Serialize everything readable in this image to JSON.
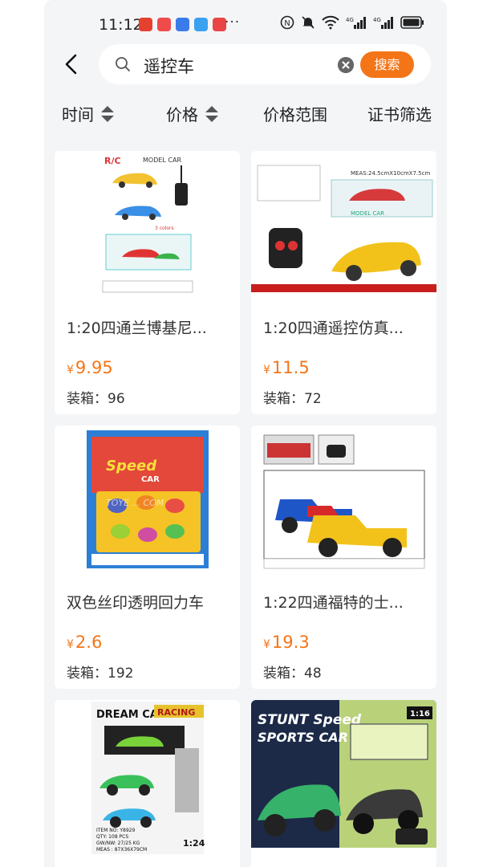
{
  "status_bar": {
    "time": "11:12",
    "more": "···",
    "app_icons": [
      {
        "name": "weibo-icon",
        "color": "#e6402e"
      },
      {
        "name": "app-red-icon",
        "color": "#ef4b4b"
      },
      {
        "name": "music-icon",
        "color": "#3a7bea"
      },
      {
        "name": "app-blue-icon",
        "color": "#3aa0f0"
      },
      {
        "name": "app-red2-icon",
        "color": "#e94545"
      }
    ],
    "battery_color": "#222222"
  },
  "search": {
    "query": "遥控车",
    "button_label": "搜索",
    "accent": "#f47518"
  },
  "filters": [
    {
      "label": "时间",
      "sortable": true
    },
    {
      "label": "价格",
      "sortable": true
    },
    {
      "label": "价格范围",
      "sortable": false
    },
    {
      "label": "证书筛选",
      "sortable": false
    }
  ],
  "products": [
    {
      "title": "1:20四通兰博基尼...",
      "currency": "¥",
      "price": "9.95",
      "pack": "装箱：96",
      "image": "toy-car-box-image"
    },
    {
      "title": "1:20四通遥控仿真...",
      "currency": "¥",
      "price": "11.5",
      "pack": "装箱：72",
      "image": "toy-car-yellow-image"
    },
    {
      "title": "双色丝印透明回力车",
      "currency": "¥",
      "price": "2.6",
      "pack": "装箱：192",
      "image": "pullback-cars-card-image"
    },
    {
      "title": "1:22四通福特的士...",
      "currency": "¥",
      "price": "19.3",
      "pack": "装箱：48",
      "image": "pickup-trucks-image"
    },
    {
      "title": "",
      "currency": "",
      "price": "",
      "pack": "",
      "image": "dream-car-box-image",
      "image_text": {
        "brand": "DREAM CAR",
        "tag": "RACING",
        "item": "ITEM NO: Y8929",
        "qty": "QTY: 108 PCS",
        "gw": "GW/NW: 27/25 KG",
        "meas": "MEAS : 87X36X79CM",
        "scale": "1:24"
      }
    },
    {
      "title": "",
      "currency": "",
      "price": "",
      "pack": "",
      "image": "stunt-sports-car-image",
      "image_text": {
        "l1": "STUNT Speed",
        "l2": "SPORTS CAR",
        "scale": "1:16"
      }
    }
  ],
  "image_text": {
    "p1": {
      "logo": "R/C",
      "model": "MODEL CAR",
      "colors": "3 colors"
    },
    "p2": {
      "meas": "MEAS:24.5cmX10cmX7.5cm",
      "model": "MODEL CAR"
    },
    "p3": {
      "speed": "Speed",
      "car": "CAR",
      "watermark": "TOYE ... COM"
    }
  }
}
